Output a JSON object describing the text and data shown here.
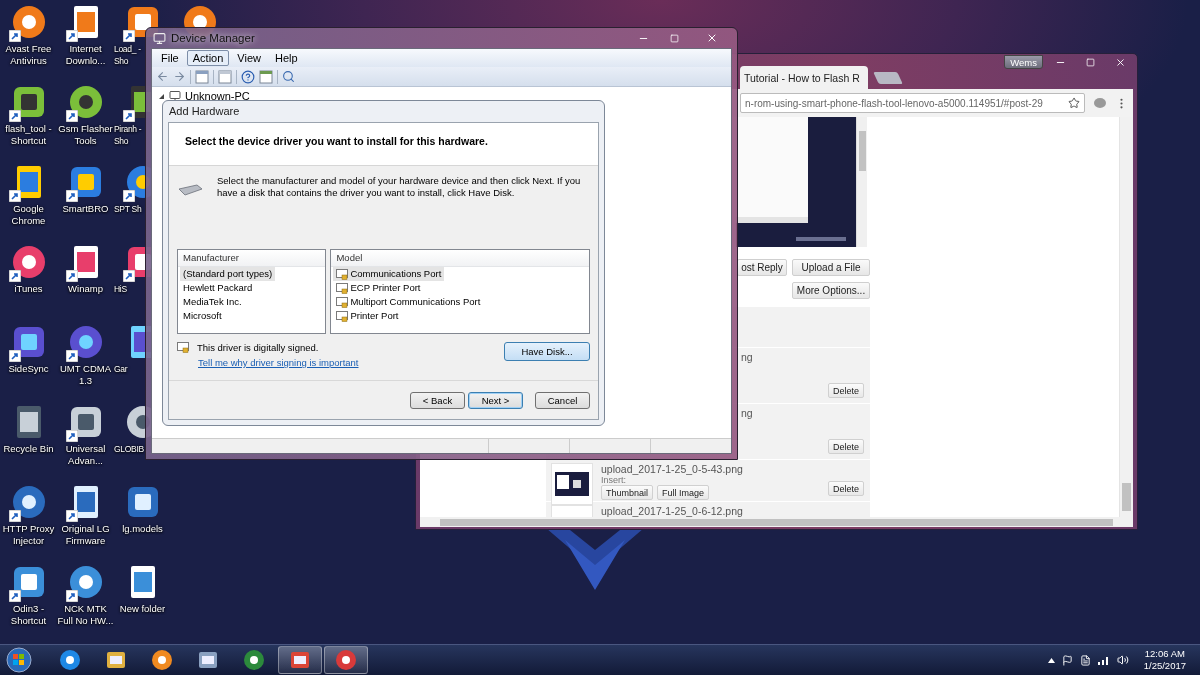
{
  "desktop_icons": [
    {
      "label": "Avast Free Antivirus",
      "shortcut": true,
      "kind": "full"
    },
    {
      "label": "flash_tool - Shortcut",
      "shortcut": true,
      "kind": "full"
    },
    {
      "label": "Google Chrome",
      "shortcut": true,
      "kind": "full"
    },
    {
      "label": "iTunes",
      "shortcut": true,
      "kind": "full"
    },
    {
      "label": "SideSync",
      "shortcut": true,
      "kind": "full"
    },
    {
      "label": "Recycle Bin",
      "shortcut": false,
      "kind": "full"
    },
    {
      "label": "HTTP Proxy Injector",
      "shortcut": true,
      "kind": "full"
    },
    {
      "label": "Odin3 - Shortcut",
      "shortcut": true,
      "kind": "full"
    },
    {
      "label": "Internet Downlo...",
      "shortcut": true,
      "kind": "full"
    },
    {
      "label": "Gsm Flasher Tools",
      "shortcut": true,
      "kind": "full"
    },
    {
      "label": "SmartBRO",
      "shortcut": true,
      "kind": "full"
    },
    {
      "label": "Winamp",
      "shortcut": true,
      "kind": "full"
    },
    {
      "label": "UMT CDMA 1.3",
      "shortcut": true,
      "kind": "full"
    },
    {
      "label": "Universal Advan...",
      "shortcut": true,
      "kind": "full"
    },
    {
      "label": "Original LG Firmware",
      "shortcut": true,
      "kind": "full"
    },
    {
      "label": "NCK MTK Full No HW...",
      "shortcut": true,
      "kind": "full"
    },
    {
      "label": "Load_ - Sho",
      "shortcut": true,
      "kind": "cut"
    },
    {
      "label": "Piranh - Sho",
      "shortcut": true,
      "kind": "cut"
    },
    {
      "label": "SPT Sh",
      "shortcut": true,
      "kind": "cut"
    },
    {
      "label": "HiS",
      "shortcut": true,
      "kind": "cut"
    },
    {
      "label": "Gar",
      "shortcut": false,
      "kind": "cut"
    },
    {
      "label": "GLOBIB",
      "shortcut": false,
      "kind": "cut"
    },
    {
      "label": "lg.models",
      "shortcut": false,
      "kind": "full"
    },
    {
      "label": "New folder",
      "shortcut": false,
      "kind": "full"
    },
    {
      "shortcut": false
    }
  ],
  "device_manager": {
    "title": "Device Manager",
    "menu": [
      {
        "label": "File",
        "selected": false
      },
      {
        "label": "Action",
        "selected": true
      },
      {
        "label": "View",
        "selected": false
      },
      {
        "label": "Help",
        "selected": false
      }
    ],
    "tree": {
      "label": "Unknown-PC",
      "expanded": true
    }
  },
  "dialog": {
    "title": "Add Hardware",
    "heading": "Select the device driver you want to install for this hardware.",
    "description": "Select the manufacturer and model of your hardware device and then click Next. If you have a disk that contains the driver you want to install, click Have Disk.",
    "manufacturer_header": "Manufacturer",
    "manufacturers": [
      {
        "label": "(Standard port types)",
        "selected": true
      },
      {
        "label": "Hewlett Packard",
        "selected": false
      },
      {
        "label": "MediaTek Inc.",
        "selected": false
      },
      {
        "label": "Microsoft",
        "selected": false
      }
    ],
    "model_header": "Model",
    "models": [
      {
        "label": "Communications Port",
        "selected": true
      },
      {
        "label": "ECP Printer Port",
        "selected": false
      },
      {
        "label": "Multiport Communications Port",
        "selected": false
      },
      {
        "label": "Printer Port",
        "selected": false
      }
    ],
    "signed_text": "This driver is digitally signed.",
    "link": "Tell me why driver signing is important",
    "have_disk": "Have Disk...",
    "buttons": [
      {
        "label": "< Back",
        "default": false
      },
      {
        "label": "Next >",
        "default": true
      },
      {
        "label": "Cancel",
        "default": false
      }
    ]
  },
  "browser": {
    "tab_title": "Tutorial - How to Flash R",
    "profile": "Wems",
    "url": "n-rom-using-smart-phone-flash-tool-lenovo-a5000.114951/#post-29",
    "post_reply": "ost Reply",
    "upload": "Upload a File",
    "more_options": "More Options...",
    "attachments": [
      {
        "name": "ng",
        "clipped": true,
        "delete": "Delete"
      },
      {
        "name": "ng",
        "clipped": true,
        "delete": "Delete"
      },
      {
        "name": "upload_2017-1-25_0-5-43.png",
        "clipped": false,
        "insert": "Insert:",
        "actions": [
          "Thumbnail",
          "Full Image"
        ],
        "delete": "Delete"
      },
      {
        "name": "upload_2017-1-25_0-6-12.png",
        "clipped": false
      }
    ]
  },
  "taskbar": {
    "apps": [
      {
        "running": false
      },
      {
        "running": false
      },
      {
        "running": false
      },
      {
        "running": false
      },
      {
        "running": false
      },
      {
        "running": true
      },
      {
        "running": true
      }
    ],
    "time": "12:06 AM",
    "date": "1/25/2017"
  }
}
